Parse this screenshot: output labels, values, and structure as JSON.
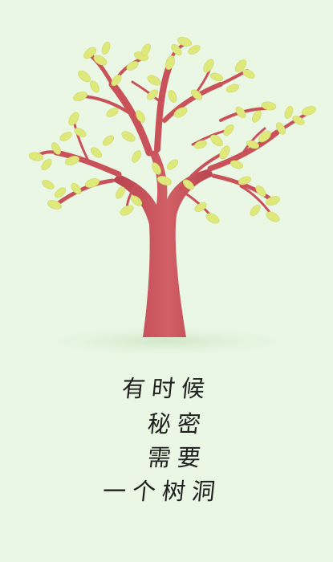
{
  "background_color": "#e9f7e4",
  "trunk_color": "#c9525a",
  "leaf_color": "#dfe87a",
  "poem": {
    "lines": [
      "有时候",
      "秘密",
      "需要",
      "一个树洞"
    ]
  }
}
